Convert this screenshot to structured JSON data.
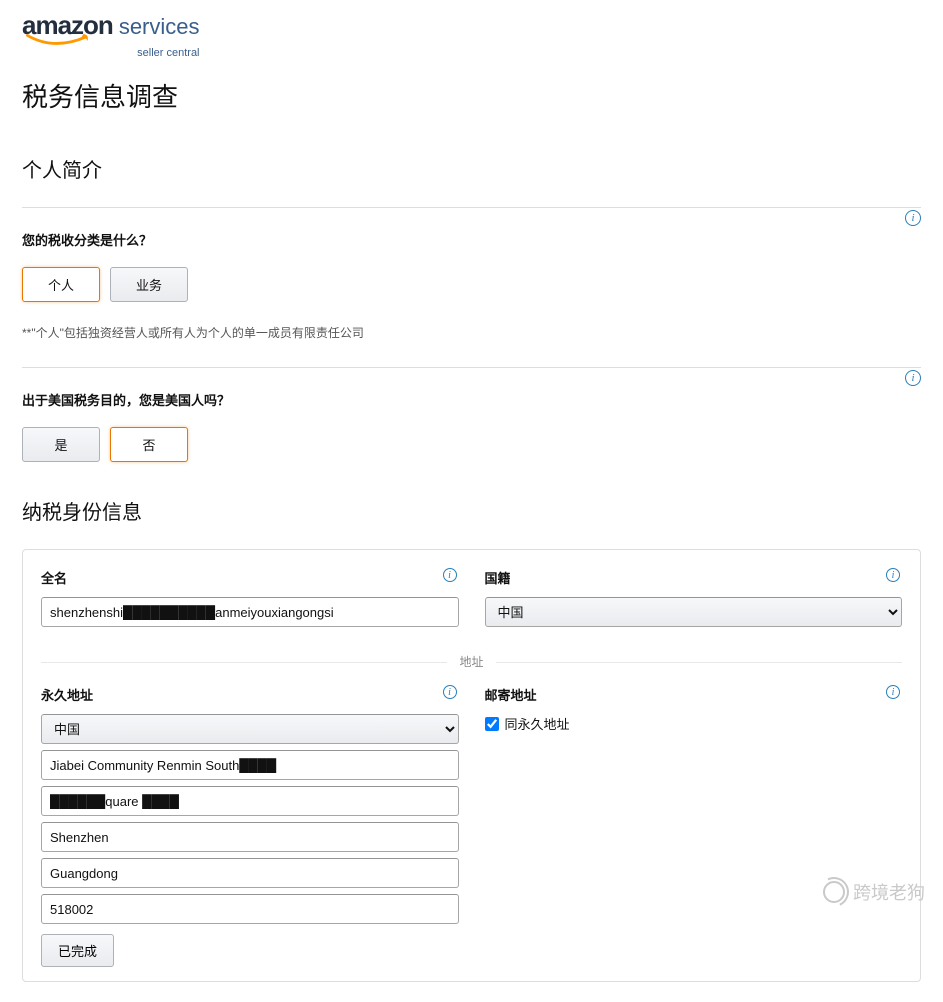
{
  "logo": {
    "brand": "amazon",
    "services": "services",
    "subline": "seller central"
  },
  "page": {
    "title": "税务信息调查",
    "profile_heading": "个人简介",
    "tax_id_heading": "纳税身份信息"
  },
  "q1": {
    "label": "您的税收分类是什么？",
    "opt_individual": "个人",
    "opt_business": "业务",
    "hint": "**\"个人\"包括独资经营人或所有人为个人的单一成员有限责任公司"
  },
  "q2": {
    "label": "出于美国税务目的，您是美国人吗？",
    "opt_yes": "是",
    "opt_no": "否"
  },
  "form": {
    "full_name_label": "全名",
    "full_name_value": "shenzhenshi██████████anmeiyouxiangongsi",
    "nationality_label": "国籍",
    "nationality_value": "中国",
    "address_divider": "地址",
    "perm_addr_label": "永久地址",
    "mail_addr_label": "邮寄地址",
    "same_as_perm_label": "同永久地址",
    "country_value": "中国",
    "line1": "Jiabei Community Renmin South████",
    "line2": "██████quare ████",
    "city": "Shenzhen",
    "province": "Guangdong",
    "postal": "518002",
    "done_label": "已完成"
  },
  "watermark": "跨境老狗"
}
